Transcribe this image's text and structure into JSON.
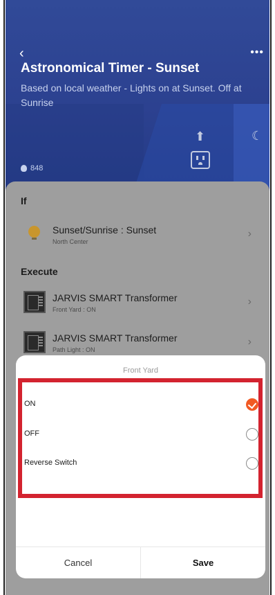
{
  "header": {
    "title": "Astronomical Timer - Sunset",
    "description": "Based on local weather - Lights on at Sunset. Off at Sunrise",
    "likes": "848",
    "back_icon": "chevron-left-icon",
    "more_icon": "more-horizontal-icon"
  },
  "if_section": {
    "label": "If",
    "condition": {
      "title": "Sunset/Sunrise : Sunset",
      "subtitle": "North Center",
      "icon": "bulb-icon"
    }
  },
  "execute_section": {
    "label": "Execute",
    "actions": [
      {
        "title": "JARVIS SMART Transformer",
        "subtitle": "Front Yard : ON",
        "icon": "transformer-icon"
      },
      {
        "title": "JARVIS SMART Transformer",
        "subtitle": "Path Light : ON",
        "icon": "transformer-icon"
      }
    ]
  },
  "sheet": {
    "title": "Front Yard",
    "options": [
      {
        "label": "ON",
        "selected": true
      },
      {
        "label": "OFF",
        "selected": false
      },
      {
        "label": "Reverse Switch",
        "selected": false
      }
    ],
    "cancel_label": "Cancel",
    "save_label": "Save"
  },
  "colors": {
    "header_blue": "#2c4190",
    "accent_orange": "#f15a24",
    "highlight_red": "#d3232f"
  }
}
